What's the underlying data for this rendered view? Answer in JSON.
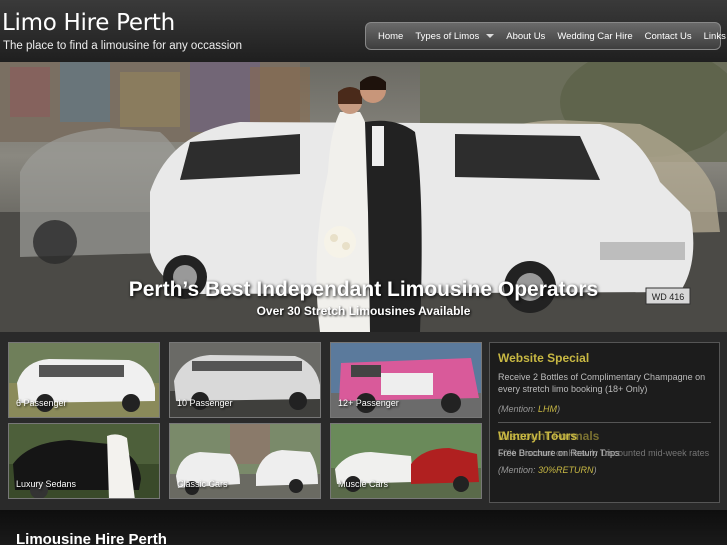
{
  "header": {
    "title": "Limo Hire Perth",
    "tagline": "The place to find a limousine for any occassion"
  },
  "nav": {
    "items": [
      {
        "label": "Home"
      },
      {
        "label": "Types of Limos",
        "dropdown": true
      },
      {
        "label": "About Us"
      },
      {
        "label": "Wedding Car Hire"
      },
      {
        "label": "Contact Us"
      },
      {
        "label": "Links"
      }
    ]
  },
  "hero": {
    "title": "Perth’s Best Independant Limousine Operators",
    "subtitle": "Over 30 Stretch Limousines Available",
    "plate_text": "WD 416"
  },
  "tiles": [
    {
      "label": "6 Passenger"
    },
    {
      "label": "10 Passenger"
    },
    {
      "label": "12+ Passenger"
    },
    {
      "label": "Luxury Sedans"
    },
    {
      "label": "Classic Cars"
    },
    {
      "label": "Muscle Cars"
    }
  ],
  "specials": {
    "website": {
      "title": "Website Special",
      "text": "Receive 2 Bottles of Complimentary Champagne on every stretch limo booking (18+ Only)",
      "mention_prefix": "(Mention:",
      "code": "LHM",
      "mention_suffix": ")"
    },
    "overlay_a": {
      "title": "Wineryl Tours",
      "text": "Free Brochure on Return Trips",
      "mention_prefix": "(Mention:",
      "code": "30%RETURN",
      "mention_suffix": ")"
    },
    "overlay_b": {
      "title": "Discount Formals",
      "text": "50% Discount on Heavily Discounted mid-week rates"
    }
  },
  "bottom": {
    "title": "Limousine Hire Perth"
  },
  "colors": {
    "accent": "#c8b843",
    "background": "#1b1b1b",
    "band": "#2a2a2a"
  }
}
